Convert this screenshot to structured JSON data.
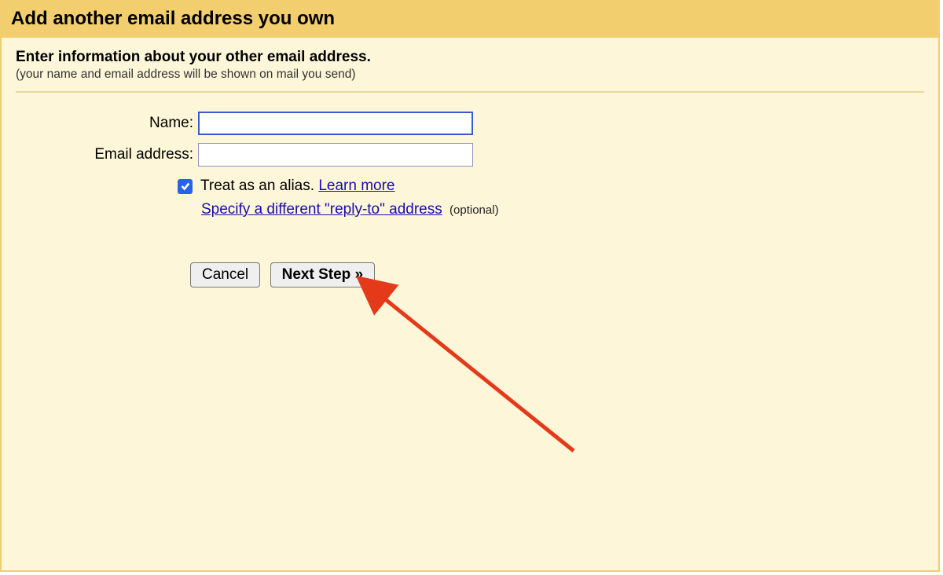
{
  "dialog": {
    "title": "Add another email address you own",
    "subheading": "Enter information about your other email address.",
    "subnote": "(your name and email address will be shown on mail you send)"
  },
  "form": {
    "name_label": "Name:",
    "name_value": "",
    "email_label": "Email address:",
    "email_value": "",
    "alias_checkbox_label": "Treat as an alias.",
    "alias_checked": true,
    "learn_more_label": "Learn more",
    "replyto_link": "Specify a different \"reply-to\" address",
    "optional_label": "(optional)"
  },
  "buttons": {
    "cancel": "Cancel",
    "next": "Next Step »"
  },
  "colors": {
    "titlebar_bg": "#f2ce6f",
    "content_bg": "#fdf6d9",
    "link_color": "#1a0dab",
    "checkbox_checked_bg": "#2563eb",
    "arrow_color": "#e43a1a"
  }
}
